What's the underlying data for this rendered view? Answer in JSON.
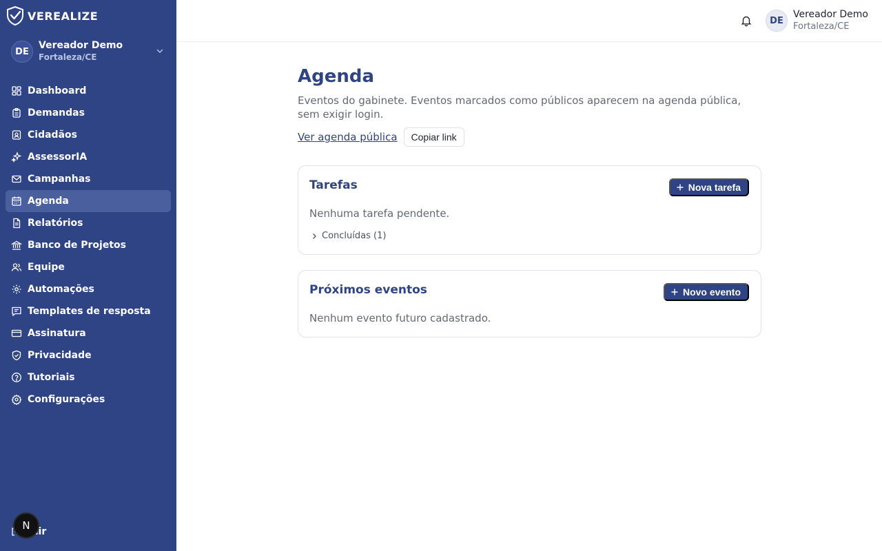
{
  "brand": {
    "name": "VEREALIZE"
  },
  "account": {
    "initials": "DE",
    "name": "Vereador Demo",
    "city": "Fortaleza/CE"
  },
  "nav": [
    {
      "label": "Dashboard",
      "icon": "dashboard-icon"
    },
    {
      "label": "Demandas",
      "icon": "clipboard-icon"
    },
    {
      "label": "Cidadãos",
      "icon": "contact-card-icon"
    },
    {
      "label": "AssessorIA",
      "icon": "sparkles-icon"
    },
    {
      "label": "Campanhas",
      "icon": "mail-icon"
    },
    {
      "label": "Agenda",
      "icon": "calendar-icon",
      "active": true
    },
    {
      "label": "Relatórios",
      "icon": "report-icon"
    },
    {
      "label": "Banco de Projetos",
      "icon": "bank-icon"
    },
    {
      "label": "Equipe",
      "icon": "users-icon"
    },
    {
      "label": "Automações",
      "icon": "cog-icon"
    },
    {
      "label": "Templates de resposta",
      "icon": "message-icon"
    },
    {
      "label": "Assinatura",
      "icon": "credit-card-icon"
    },
    {
      "label": "Privacidade",
      "icon": "shield-icon"
    },
    {
      "label": "Tutoriais",
      "icon": "help-circle-icon"
    },
    {
      "label": "Configurações",
      "icon": "settings-icon"
    }
  ],
  "logout": {
    "label": "Sair"
  },
  "dev_badge": {
    "letter": "N"
  },
  "header": {
    "initials": "DE",
    "name": "Vereador Demo",
    "city": "Fortaleza/CE"
  },
  "page": {
    "title": "Agenda",
    "description": "Eventos do gabinete. Eventos marcados como públicos aparecem na agenda pública, sem exigir login.",
    "public_link": "Ver agenda pública",
    "copy_link": "Copiar link"
  },
  "tasks": {
    "title": "Tarefas",
    "new_button": "Nova tarefa",
    "empty": "Nenhuma tarefa pendente.",
    "completed_toggle": "Concluídas (1)"
  },
  "events": {
    "title": "Próximos eventos",
    "new_button": "Novo evento",
    "empty": "Nenhum evento futuro cadastrado."
  },
  "colors": {
    "sidebar": "#2f4485",
    "accent": "#2f4485",
    "active_item": "#4a5f9e"
  }
}
